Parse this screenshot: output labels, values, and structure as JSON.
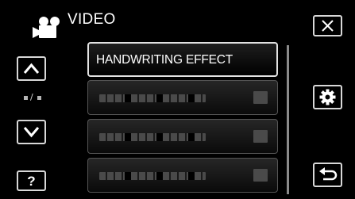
{
  "header": {
    "mode_icon": "video-camera-icon",
    "title": "VIDEO"
  },
  "controls": {
    "close_icon": "close-icon",
    "up_icon": "chevron-up-icon",
    "down_icon": "chevron-down-icon",
    "help_label": "?",
    "help_icon": "help-icon",
    "settings_icon": "gear-icon",
    "back_icon": "return-icon"
  },
  "page_indicator": {
    "separator": "/"
  },
  "menu": {
    "items": [
      {
        "label": "HANDWRITING EFFECT",
        "selected": true
      },
      {
        "label": "",
        "selected": false
      },
      {
        "label": "",
        "selected": false
      },
      {
        "label": "",
        "selected": false
      }
    ]
  },
  "colors": {
    "background": "#000000",
    "text": "#ffffff",
    "button_border": "#d8d8d8",
    "item_border": "#555555"
  }
}
